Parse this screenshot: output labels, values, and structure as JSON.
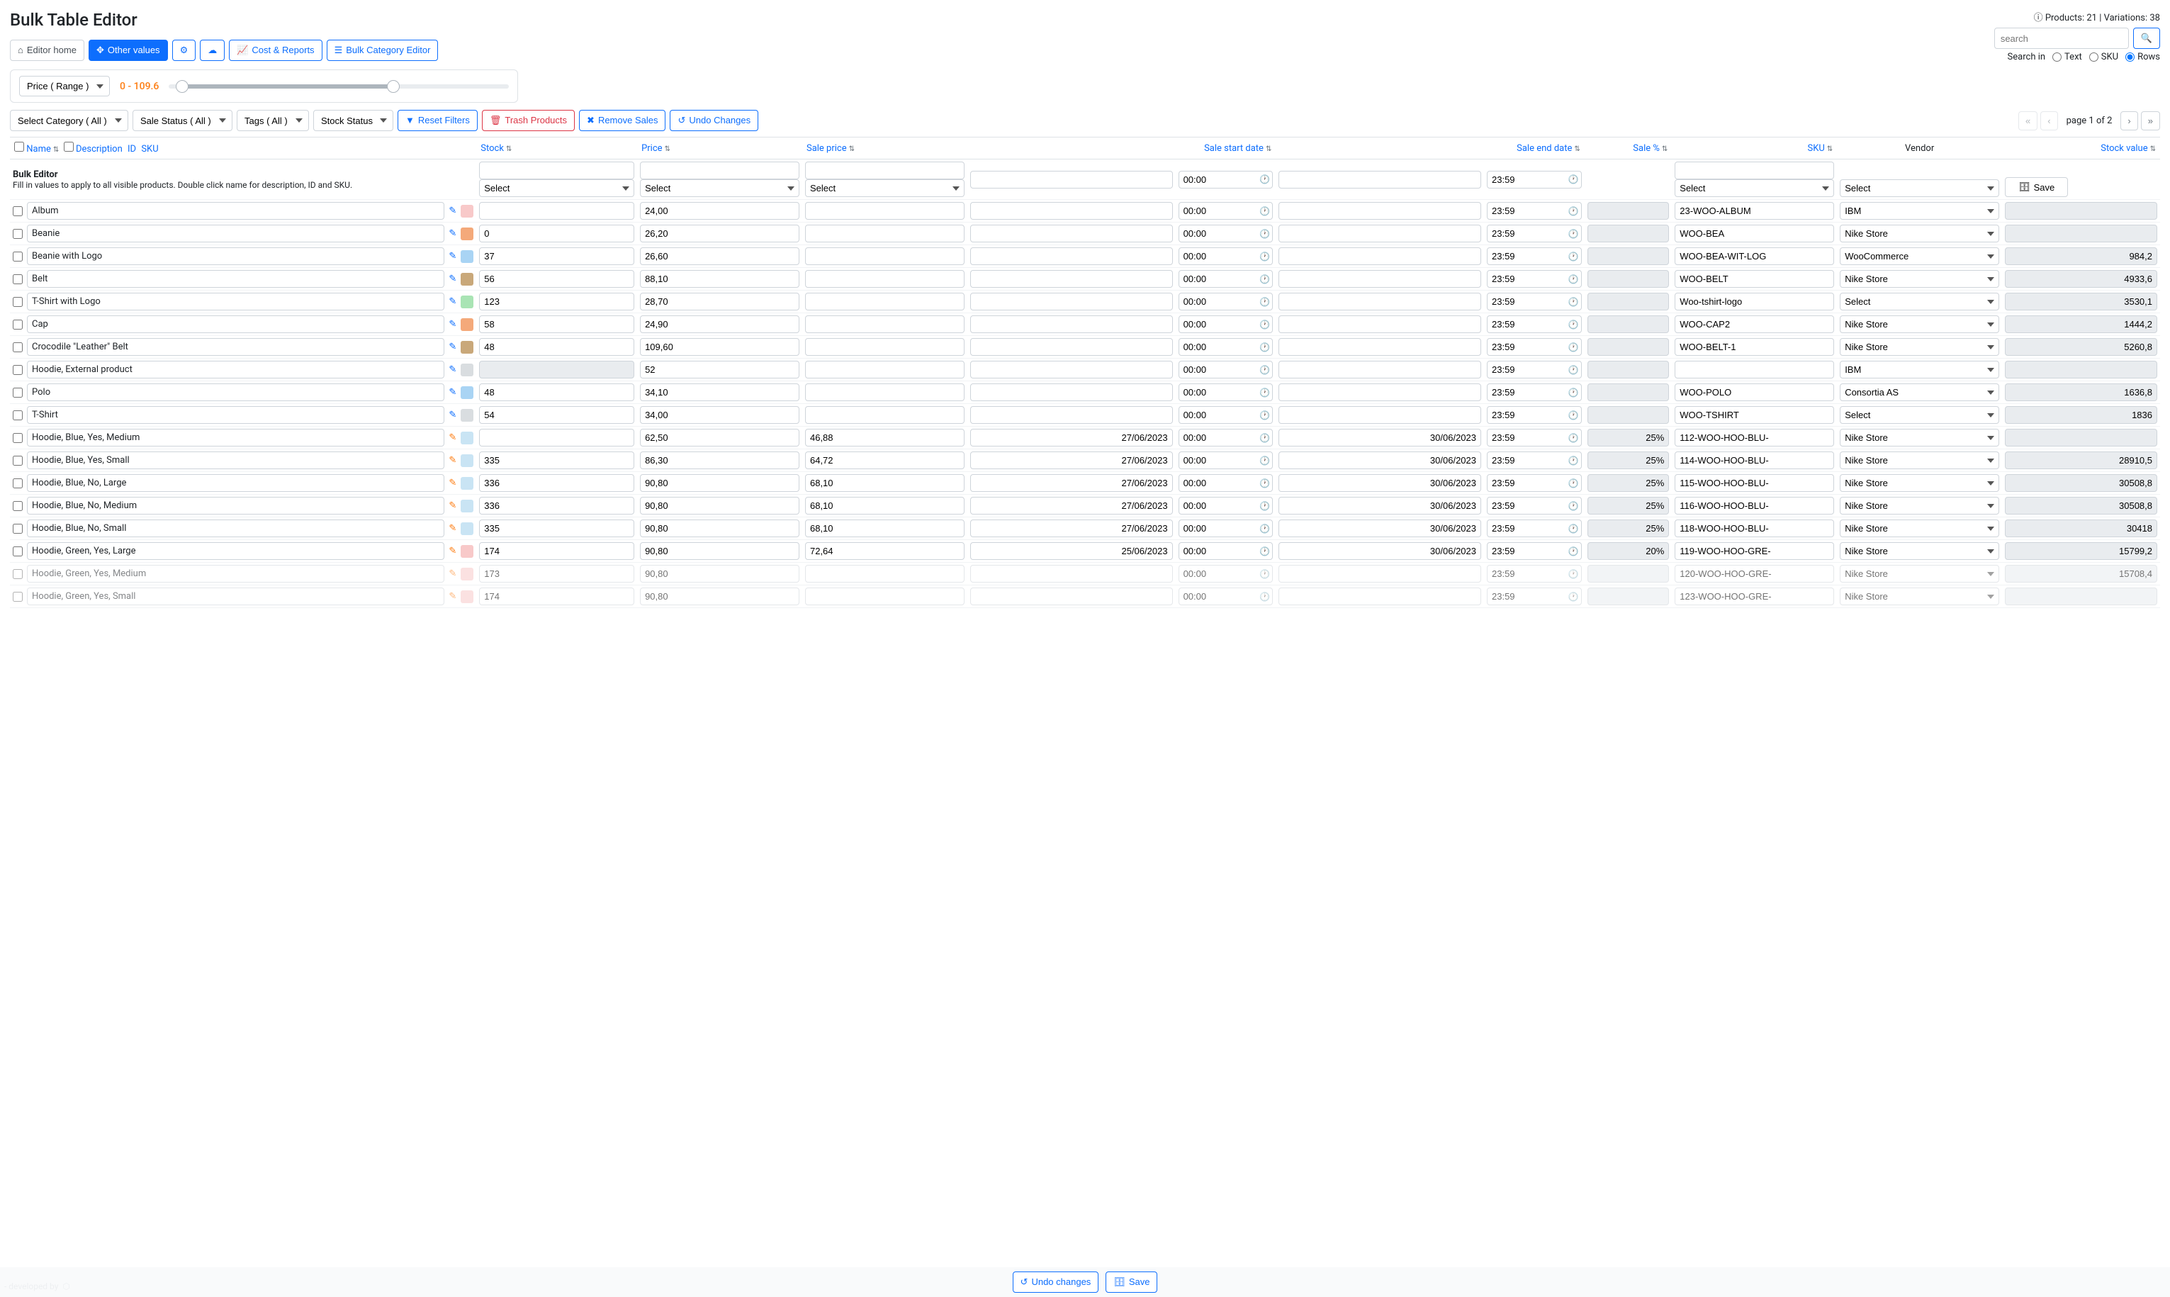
{
  "title": "Bulk Table Editor",
  "counts": "Products: 21 | Variations: 38",
  "toolbar": {
    "home": "Editor home",
    "other": "Other values",
    "cost": "Cost & Reports",
    "category": "Bulk Category Editor"
  },
  "search": {
    "placeholder": "search",
    "label": "Search in",
    "opt_text": "Text",
    "opt_sku": "SKU",
    "opt_rows": "Rows"
  },
  "range": {
    "select": "Price ( Range )",
    "value": "0 - 109.6"
  },
  "filters": {
    "category": "Select Category ( All )",
    "sale_status": "Sale Status ( All )",
    "tags": "Tags ( All )",
    "stock_status": "Stock Status",
    "reset": "Reset Filters",
    "trash": "Trash Products",
    "remove": "Remove Sales",
    "undo": "Undo Changes"
  },
  "pagination": {
    "text": "page 1 of 2"
  },
  "headers": {
    "name": "Name",
    "desc": "Description",
    "id": "ID",
    "sku_h": "SKU",
    "stock": "Stock",
    "price": "Price",
    "sale_price": "Sale price",
    "sale_start": "Sale start date",
    "sale_end": "Sale end date",
    "sale_pct": "Sale %",
    "sku": "SKU",
    "vendor": "Vendor",
    "stock_value": "Stock value"
  },
  "bulk": {
    "title": "Bulk Editor",
    "desc": "Fill in values to apply to all visible products. Double click name for description, ID and SKU.",
    "select": "Select",
    "start_time": "00:00",
    "end_time": "23:59",
    "save": "Save"
  },
  "rows": [
    {
      "name": "Album",
      "edit": "blue",
      "thumb": "pink",
      "stock": "",
      "price": "24,00",
      "sale": "",
      "start": "",
      "stime": "00:00",
      "end": "",
      "etime": "23:59",
      "pct": "",
      "pct_disabled": true,
      "sku": "23-WOO-ALBUM",
      "vendor": "IBM",
      "sv": ""
    },
    {
      "name": "Beanie",
      "edit": "blue",
      "thumb": "orange",
      "stock": "0",
      "price": "26,20",
      "sale": "",
      "start": "",
      "stime": "00:00",
      "end": "",
      "etime": "23:59",
      "pct": "",
      "pct_disabled": true,
      "sku": "WOO-BEA",
      "vendor": "Nike Store",
      "sv": ""
    },
    {
      "name": "Beanie with Logo",
      "edit": "blue",
      "thumb": "blue",
      "stock": "37",
      "price": "26,60",
      "sale": "",
      "start": "",
      "stime": "00:00",
      "end": "",
      "etime": "23:59",
      "pct": "",
      "pct_disabled": true,
      "sku": "WOO-BEA-WIT-LOG",
      "vendor": "WooCommerce",
      "sv": "984,2"
    },
    {
      "name": "Belt",
      "edit": "blue",
      "thumb": "brown",
      "stock": "56",
      "price": "88,10",
      "sale": "",
      "start": "",
      "stime": "00:00",
      "end": "",
      "etime": "23:59",
      "pct": "",
      "pct_disabled": true,
      "sku": "WOO-BELT",
      "vendor": "Nike Store",
      "sv": "4933,6"
    },
    {
      "name": "T-Shirt with Logo",
      "edit": "blue",
      "thumb": "green",
      "stock": "123",
      "price": "28,70",
      "sale": "",
      "start": "",
      "stime": "00:00",
      "end": "",
      "etime": "23:59",
      "pct": "",
      "pct_disabled": true,
      "sku": "Woo-tshirt-logo",
      "vendor": "Select",
      "sv": "3530,1"
    },
    {
      "name": "Cap",
      "edit": "blue",
      "thumb": "orange",
      "stock": "58",
      "price": "24,90",
      "sale": "",
      "start": "",
      "stime": "00:00",
      "end": "",
      "etime": "23:59",
      "pct": "",
      "pct_disabled": true,
      "sku": "WOO-CAP2",
      "vendor": "Nike Store",
      "sv": "1444,2"
    },
    {
      "name": "Crocodile \"Leather\" Belt",
      "edit": "blue",
      "thumb": "brown",
      "stock": "48",
      "price": "109,60",
      "sale": "",
      "start": "",
      "stime": "00:00",
      "end": "",
      "etime": "23:59",
      "pct": "",
      "pct_disabled": true,
      "sku": "WOO-BELT-1",
      "vendor": "Nike Store",
      "sv": "5260,8"
    },
    {
      "name": "Hoodie, External product",
      "edit": "blue",
      "thumb": "gray",
      "stock": "",
      "stock_disabled": true,
      "price": "52",
      "sale": "",
      "start": "",
      "stime": "00:00",
      "end": "",
      "etime": "23:59",
      "pct": "",
      "pct_disabled": true,
      "sku": "",
      "vendor": "IBM",
      "sv": ""
    },
    {
      "name": "Polo",
      "edit": "blue",
      "thumb": "blue",
      "stock": "48",
      "price": "34,10",
      "sale": "",
      "start": "",
      "stime": "00:00",
      "end": "",
      "etime": "23:59",
      "pct": "",
      "pct_disabled": true,
      "sku": "WOO-POLO",
      "vendor": "Consortia AS",
      "sv": "1636,8"
    },
    {
      "name": "T-Shirt",
      "edit": "blue",
      "thumb": "gray",
      "stock": "54",
      "price": "34,00",
      "sale": "",
      "start": "",
      "stime": "00:00",
      "end": "",
      "etime": "23:59",
      "pct": "",
      "pct_disabled": true,
      "sku": "WOO-TSHIRT",
      "vendor": "Select",
      "sv": "1836"
    },
    {
      "name": "Hoodie, Blue, Yes, Medium",
      "edit": "orange",
      "thumb": "lightblue",
      "stock": "",
      "price": "62,50",
      "sale": "46,88",
      "start": "27/06/2023",
      "stime": "00:00",
      "end": "30/06/2023",
      "etime": "23:59",
      "pct": "25%",
      "pct_disabled": true,
      "sku": "112-WOO-HOO-BLU-",
      "vendor": "Nike Store",
      "sv": ""
    },
    {
      "name": "Hoodie, Blue, Yes, Small",
      "edit": "orange",
      "thumb": "lightblue",
      "stock": "335",
      "price": "86,30",
      "sale": "64,72",
      "start": "27/06/2023",
      "stime": "00:00",
      "end": "30/06/2023",
      "etime": "23:59",
      "pct": "25%",
      "pct_disabled": true,
      "sku": "114-WOO-HOO-BLU-",
      "vendor": "Nike Store",
      "sv": "28910,5"
    },
    {
      "name": "Hoodie, Blue, No, Large",
      "edit": "orange",
      "thumb": "lightblue",
      "stock": "336",
      "price": "90,80",
      "sale": "68,10",
      "start": "27/06/2023",
      "stime": "00:00",
      "end": "30/06/2023",
      "etime": "23:59",
      "pct": "25%",
      "pct_disabled": true,
      "sku": "115-WOO-HOO-BLU-",
      "vendor": "Nike Store",
      "sv": "30508,8"
    },
    {
      "name": "Hoodie, Blue, No, Medium",
      "edit": "orange",
      "thumb": "lightblue",
      "stock": "336",
      "price": "90,80",
      "sale": "68,10",
      "start": "27/06/2023",
      "stime": "00:00",
      "end": "30/06/2023",
      "etime": "23:59",
      "pct": "25%",
      "pct_disabled": true,
      "sku": "116-WOO-HOO-BLU-",
      "vendor": "Nike Store",
      "sv": "30508,8"
    },
    {
      "name": "Hoodie, Blue, No, Small",
      "edit": "orange",
      "thumb": "lightblue",
      "stock": "335",
      "price": "90,80",
      "sale": "68,10",
      "start": "27/06/2023",
      "stime": "00:00",
      "end": "30/06/2023",
      "etime": "23:59",
      "pct": "25%",
      "pct_disabled": true,
      "sku": "118-WOO-HOO-BLU-",
      "vendor": "Nike Store",
      "sv": "30418"
    },
    {
      "name": "Hoodie, Green, Yes, Large",
      "edit": "orange",
      "thumb": "pink",
      "stock": "174",
      "price": "90,80",
      "sale": "72,64",
      "start": "25/06/2023",
      "stime": "00:00",
      "end": "30/06/2023",
      "etime": "23:59",
      "pct": "20%",
      "pct_disabled": true,
      "sku": "119-WOO-HOO-GRE-",
      "vendor": "Nike Store",
      "sv": "15799,2"
    },
    {
      "name": "Hoodie, Green, Yes, Medium",
      "edit": "orange",
      "thumb": "pink",
      "stock": "173",
      "price": "90,80",
      "sale": "",
      "start": "",
      "stime": "00:00",
      "end": "",
      "etime": "23:59",
      "pct": "",
      "pct_disabled": true,
      "sku": "120-WOO-HOO-GRE-",
      "vendor": "Nike Store",
      "sv": "15708,4",
      "faded": true
    },
    {
      "name": "Hoodie, Green, Yes, Small",
      "edit": "orange",
      "thumb": "pink",
      "stock": "174",
      "price": "90,80",
      "sale": "",
      "start": "",
      "stime": "00:00",
      "end": "",
      "etime": "23:59",
      "pct": "",
      "pct_disabled": true,
      "sku": "123-WOO-HOO-GRE-",
      "vendor": "Nike Store",
      "sv": "",
      "faded": true
    }
  ],
  "footer": {
    "undo": "Undo changes",
    "save": "Save",
    "dev": "- developed by"
  }
}
